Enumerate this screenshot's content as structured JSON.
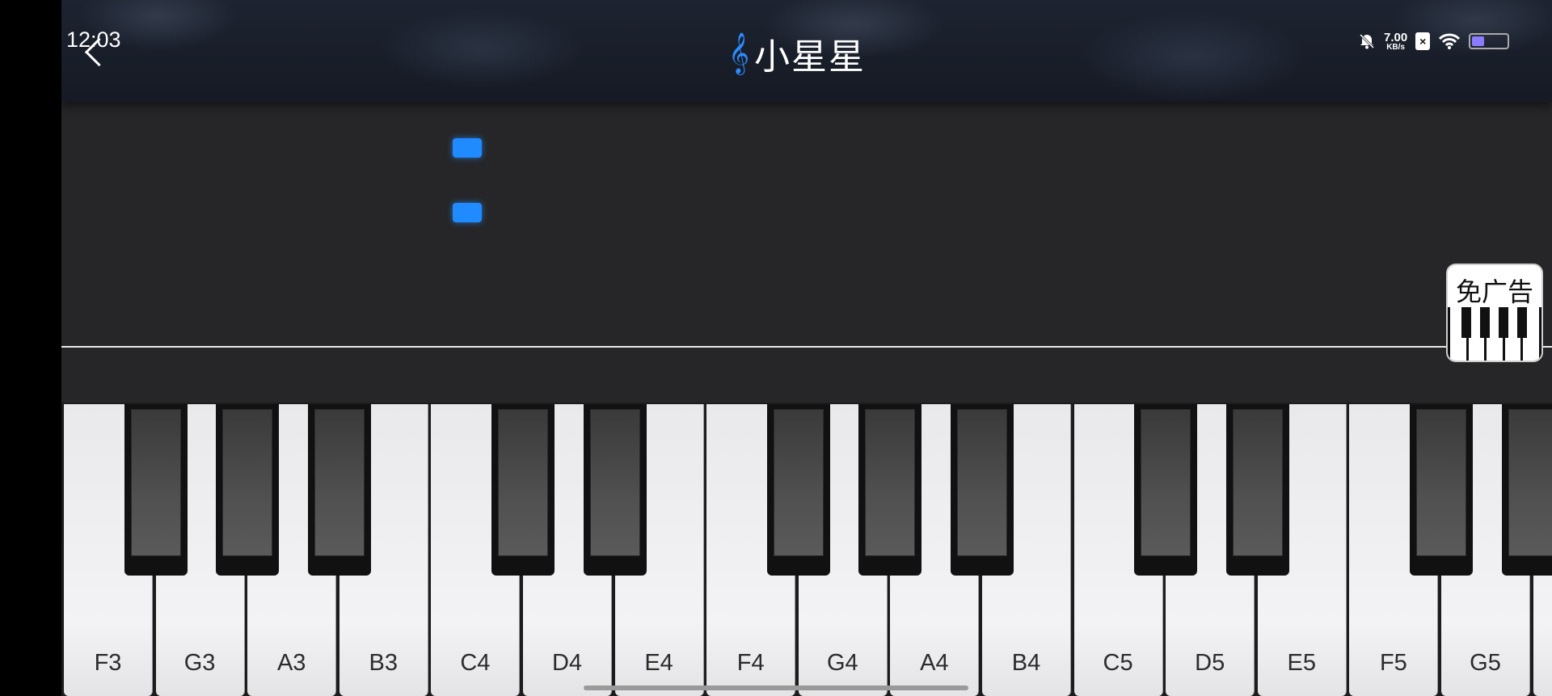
{
  "status_bar": {
    "time": "12:03",
    "net_speed_value": "7.00",
    "net_speed_unit": "KB/s",
    "battery_level": 0.35,
    "icons": [
      "mute-bell-icon",
      "sim-x-icon",
      "wifi-icon",
      "battery-icon"
    ]
  },
  "header": {
    "back_icon": "chevron-left-icon",
    "title_icon": "treble-clef-icon",
    "title": "小星星"
  },
  "ad_badge": {
    "label": "免广告",
    "icon": "piano-keys-icon"
  },
  "keyboard": {
    "white_keys": [
      "F3",
      "G3",
      "A3",
      "B3",
      "C4",
      "D4",
      "E4",
      "F4",
      "G4",
      "A4",
      "B4",
      "C5",
      "D5",
      "E5",
      "F5",
      "G5"
    ]
  },
  "colors": {
    "note": "#1f8bff",
    "accent": "#2b8cff",
    "background": "#262628"
  }
}
